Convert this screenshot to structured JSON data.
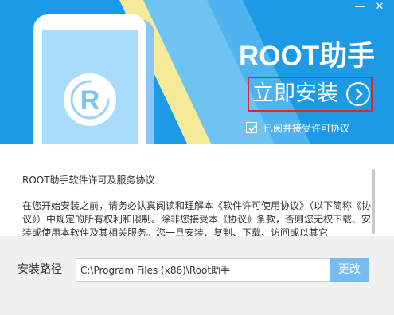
{
  "window": {
    "minimize_icon": "minimize-icon",
    "close_icon": "close-icon"
  },
  "banner": {
    "title": "ROOT助手",
    "install_label": "立即安装",
    "install_icon": "arrow-right-circle-icon",
    "agree_label": "已阅并接受许可协议",
    "agree_checked": true,
    "logo_letter": "R",
    "colors": {
      "background": "#1c9ae6",
      "stripe": "#6fc3f3",
      "stripe_accent": "#f6e99a",
      "highlight_border": "#e0232d"
    }
  },
  "license": {
    "heading": "ROOT助手软件许可及服务协议",
    "body": "在您开始安装之前，请务必认真阅读和理解本《软件许可使用协议》（以下简称《协议》）中规定的所有权利和限制。除非您接受本《协议》条款，否则您无权下载、安装或使用本软件及其相关服务。您一旦安装、复制、下载、访问或以其它"
  },
  "footer": {
    "path_label": "安装路径",
    "path_value": "C:\\Program Files (x86)\\Root助手",
    "change_label": "更改",
    "change_color": "#75bcf2"
  }
}
